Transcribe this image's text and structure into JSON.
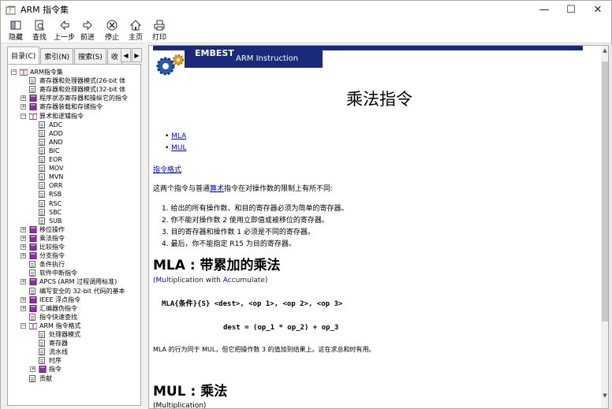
{
  "window": {
    "title": "ARM 指令集",
    "minimize": "—",
    "maximize": "☐",
    "close": "✕"
  },
  "toolbar": [
    {
      "label": "隐藏",
      "icon": "hide-icon"
    },
    {
      "label": "查找",
      "icon": "find-icon"
    },
    {
      "label": "上一步",
      "icon": "back-arrow-icon"
    },
    {
      "label": "前进",
      "icon": "forward-arrow-icon"
    },
    {
      "label": "停止",
      "icon": "stop-icon"
    },
    {
      "label": "主页",
      "icon": "home-icon"
    },
    {
      "label": "打印",
      "icon": "print-icon"
    }
  ],
  "tabs": [
    "目录(C)",
    "索引(N)",
    "搜索(S)",
    "收"
  ],
  "tree": [
    {
      "label": "ARM指令集",
      "depth": 0,
      "type": "book-open",
      "toggle": "−"
    },
    {
      "label": "寄存器和处理器模式(26-bit 体",
      "depth": 1,
      "type": "page"
    },
    {
      "label": "寄存器和处理器模式(32-bit 体",
      "depth": 1,
      "type": "page"
    },
    {
      "label": "程序状态寄存器和操纵它的指令",
      "depth": 1,
      "type": "book",
      "toggle": "+"
    },
    {
      "label": "寄存器装载和存储指令",
      "depth": 1,
      "type": "book",
      "toggle": "+"
    },
    {
      "label": "算术和逻辑指令",
      "depth": 1,
      "type": "book-open",
      "toggle": "−"
    },
    {
      "label": "ADC",
      "depth": 2,
      "type": "page"
    },
    {
      "label": "ADD",
      "depth": 2,
      "type": "page"
    },
    {
      "label": "AND",
      "depth": 2,
      "type": "page"
    },
    {
      "label": "BIC",
      "depth": 2,
      "type": "page"
    },
    {
      "label": "EOR",
      "depth": 2,
      "type": "page"
    },
    {
      "label": "MOV",
      "depth": 2,
      "type": "page"
    },
    {
      "label": "MVN",
      "depth": 2,
      "type": "page"
    },
    {
      "label": "ORR",
      "depth": 2,
      "type": "page"
    },
    {
      "label": "RSB",
      "depth": 2,
      "type": "page"
    },
    {
      "label": "RSC",
      "depth": 2,
      "type": "page"
    },
    {
      "label": "SBC",
      "depth": 2,
      "type": "page"
    },
    {
      "label": "SUB",
      "depth": 2,
      "type": "page"
    },
    {
      "label": "移位操作",
      "depth": 1,
      "type": "book",
      "toggle": "+"
    },
    {
      "label": "乘法指令",
      "depth": 1,
      "type": "book",
      "toggle": "+"
    },
    {
      "label": "比较指令",
      "depth": 1,
      "type": "book",
      "toggle": "+"
    },
    {
      "label": "分支指令",
      "depth": 1,
      "type": "book",
      "toggle": "+"
    },
    {
      "label": "条件执行",
      "depth": 1,
      "type": "page"
    },
    {
      "label": "软件中断指令",
      "depth": 1,
      "type": "page"
    },
    {
      "label": "APCS (ARM 过程调用标准)",
      "depth": 1,
      "type": "book",
      "toggle": "+"
    },
    {
      "label": "编写安全的 32-bit 代码的基本",
      "depth": 1,
      "type": "page"
    },
    {
      "label": "IEEE 浮点指令",
      "depth": 1,
      "type": "book",
      "toggle": "+"
    },
    {
      "label": "汇编器伪指令",
      "depth": 1,
      "type": "book",
      "toggle": "+"
    },
    {
      "label": "指令快速查找",
      "depth": 1,
      "type": "page"
    },
    {
      "label": "ARM 指令格式",
      "depth": 1,
      "type": "book-open",
      "toggle": "−"
    },
    {
      "label": "处理器模式",
      "depth": 2,
      "type": "page"
    },
    {
      "label": "寄存器",
      "depth": 2,
      "type": "page"
    },
    {
      "label": "流水线",
      "depth": 2,
      "type": "page"
    },
    {
      "label": "时序",
      "depth": 2,
      "type": "page"
    },
    {
      "label": "指令",
      "depth": 2,
      "type": "book",
      "toggle": "+"
    },
    {
      "label": "贡献",
      "depth": 1,
      "type": "page"
    }
  ],
  "banner": {
    "brand": "EMBEST",
    "subtitle": "ARM Instruction"
  },
  "content": {
    "title": "乘法指令",
    "links": [
      "MLA",
      "MUL"
    ],
    "format_link": "指令格式",
    "intro_pre": "这两个指令与普通",
    "intro_link": "算术",
    "intro_post": "指令在对操作数的限制上有所不同:",
    "rules": [
      "1.   给出的所有操作数、和目的寄存器必须为简单的寄存器。",
      "2.   你不能对操作数 2 使用立即值或被移位的寄存器。",
      "3.   目的寄存器和操作数 1 必须是不同的寄存器。",
      "4.   最后，你不能指定 R15 为目的寄存器。"
    ],
    "mla_heading": "MLA : 带累加的乘法",
    "mla_desc_open": "(",
    "mla_desc_m": "M",
    "mla_desc_1": "ultiplication with ",
    "mla_desc_a": "A",
    "mla_desc_2": "ccumulate)",
    "mla_syntax": "MLA{条件}{S}  <dest>, <op 1>, <op 2>, <op 3>",
    "mla_formula": "dest = (op_1 * op_2) + op_3",
    "mla_note": "MLA 的行为同于 MUL，但它把操作数 3 的值加到结果上。这在求总和时有用。",
    "mul_heading": "MUL : 乘法",
    "mul_desc": "(Multiplication)"
  },
  "colors": {
    "banner": "#1a2a7a",
    "link": "#0000ee"
  }
}
